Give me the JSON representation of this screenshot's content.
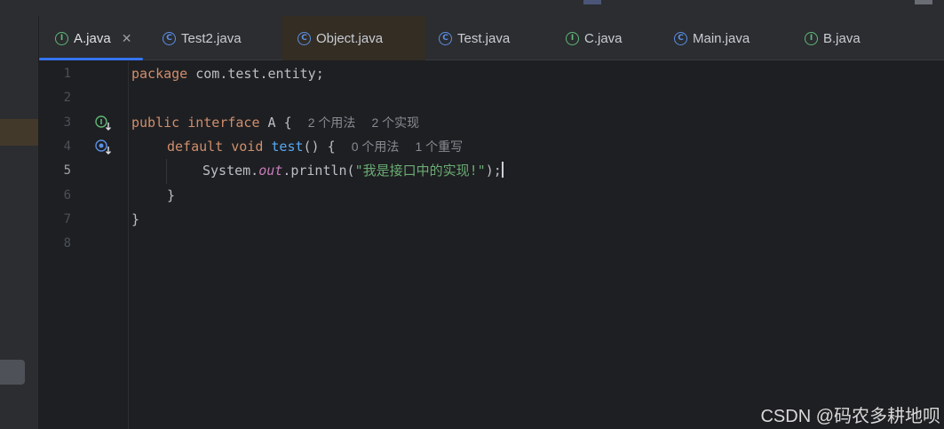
{
  "tabs": [
    {
      "label": "A.java",
      "icon": "interface-icon",
      "active": true,
      "closable": true
    },
    {
      "label": "Test2.java",
      "icon": "class-icon"
    },
    {
      "label": "Object.java",
      "icon": "class-icon"
    },
    {
      "label": "Test.java",
      "icon": "class-icon"
    },
    {
      "label": "C.java",
      "icon": "interface-icon"
    },
    {
      "label": "Main.java",
      "icon": "runnable-class-icon"
    },
    {
      "label": "B.java",
      "icon": "interface-icon"
    }
  ],
  "gutter": {
    "line_numbers": [
      "1",
      "2",
      "3",
      "4",
      "5",
      "6",
      "7",
      "8"
    ],
    "current_line": "5"
  },
  "code": {
    "line1": {
      "kw": "package",
      "rest": " com.test.entity;"
    },
    "line3": {
      "kw1": "public",
      "kw2": "interface",
      "name": " A {",
      "hint1": "2 个用法",
      "hint2": "2 个实现"
    },
    "line4": {
      "kw1": "default",
      "kw2": "void",
      "method": "test",
      "rest": "() {",
      "hint1": "0 个用法",
      "hint2": "1 个重写"
    },
    "line5": {
      "cls": "System.",
      "field": "out",
      "call": ".println(",
      "string": "\"我是接口中的实现!\"",
      "end": ");"
    },
    "line6": "}",
    "line7": "}"
  },
  "watermark": "CSDN @码农多耕地呗",
  "colors": {
    "keyword": "#cf8e6d",
    "method": "#56a8f5",
    "string": "#6aab73",
    "static_field": "#c77dbb",
    "accent": "#3574f0",
    "background": "#1e1f22"
  }
}
